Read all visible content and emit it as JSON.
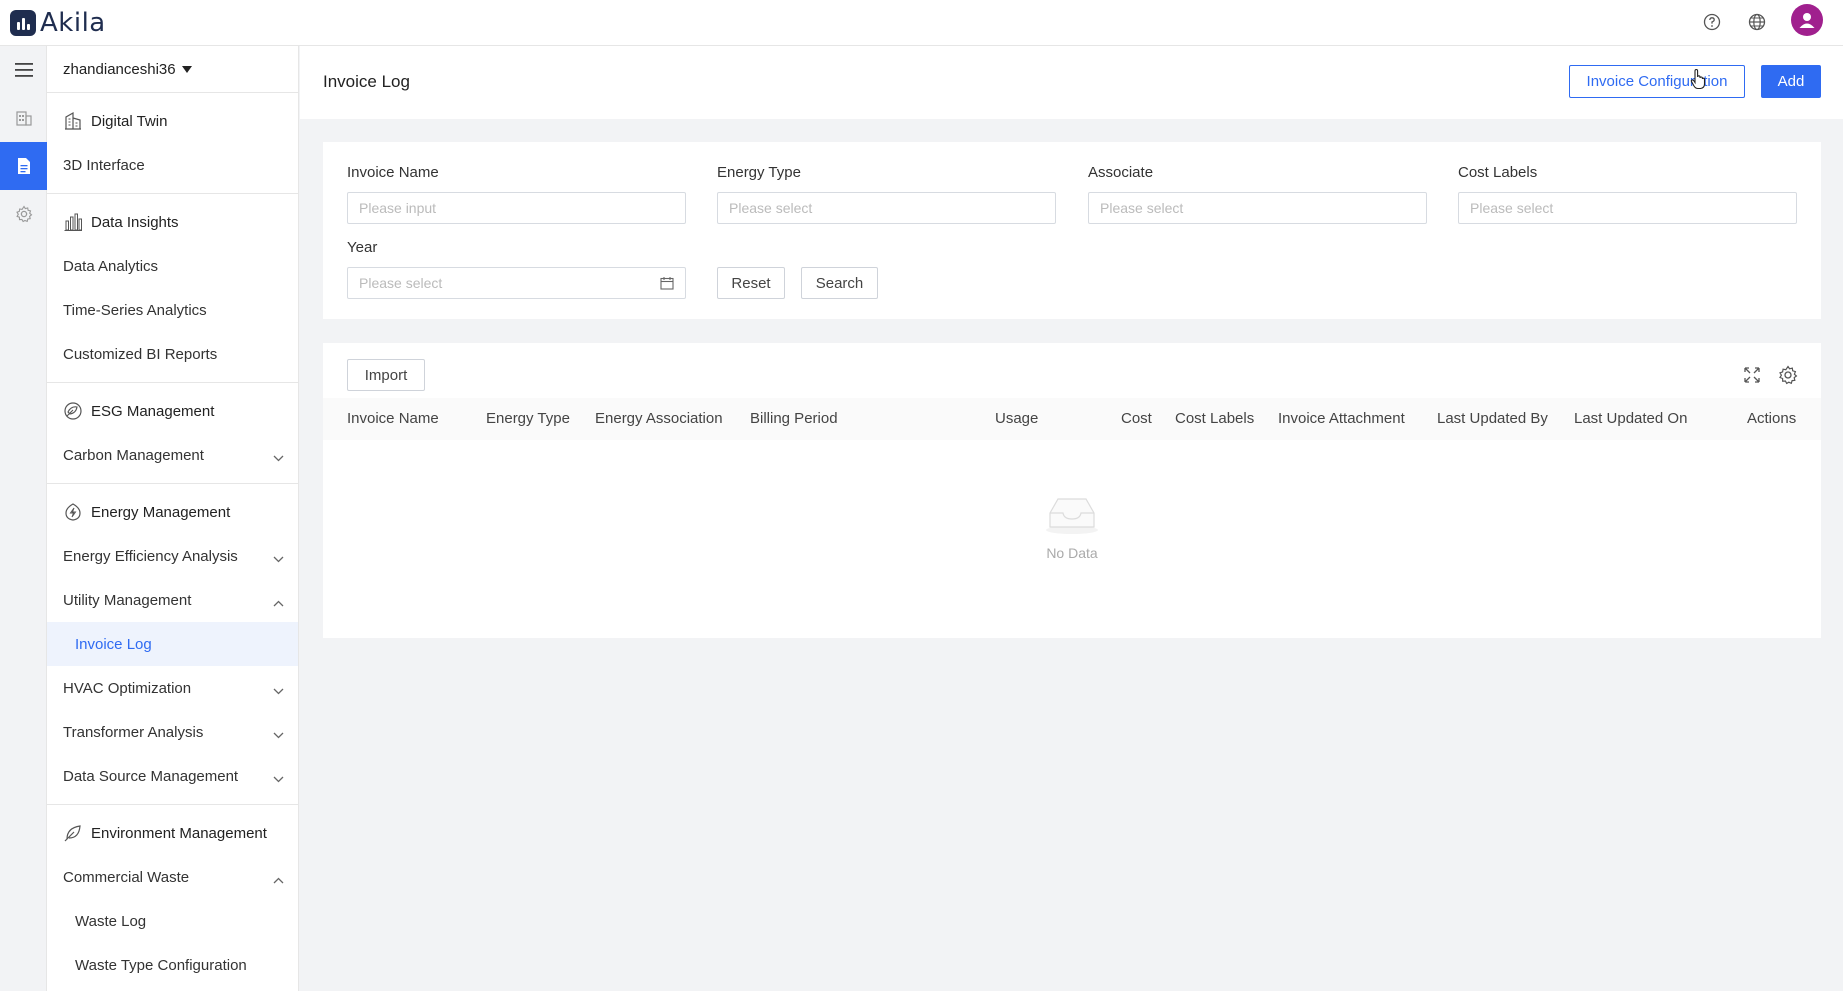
{
  "app": {
    "logo_text": "Akila"
  },
  "colors": {
    "primary": "#2f6bf2",
    "brand": "#1f2d4f",
    "avatar": "#a0208e"
  },
  "header": {
    "icons": [
      "help-icon",
      "globe-icon",
      "user-avatar-icon"
    ]
  },
  "sidebar": {
    "project": "zhandianceshi36",
    "groups": [
      {
        "title": "Digital Twin",
        "items": [
          "3D Interface"
        ]
      },
      {
        "title": "Data Insights",
        "items": [
          "Data Analytics",
          "Time-Series Analytics",
          "Customized BI Reports"
        ]
      },
      {
        "title": "ESG Management",
        "items": [
          "Carbon Management"
        ]
      },
      {
        "title": "Energy Management",
        "items": [
          "Energy Efficiency Analysis",
          "Utility Management",
          "Invoice Log",
          "HVAC Optimization",
          "Transformer Analysis",
          "Data Source Management"
        ]
      },
      {
        "title": "Environment Management",
        "items": [
          "Commercial Waste",
          "Waste Log",
          "Waste Type Configuration"
        ]
      }
    ]
  },
  "page": {
    "title": "Invoice Log",
    "invoice_config_label": "Invoice Configuration",
    "add_label": "Add"
  },
  "filters": {
    "invoice_name": {
      "label": "Invoice Name",
      "placeholder": "Please input"
    },
    "energy_type": {
      "label": "Energy Type",
      "placeholder": "Please select"
    },
    "associate": {
      "label": "Associate",
      "placeholder": "Please select"
    },
    "cost_labels": {
      "label": "Cost Labels",
      "placeholder": "Please select"
    },
    "year": {
      "label": "Year",
      "placeholder": "Please select"
    },
    "reset_label": "Reset",
    "search_label": "Search"
  },
  "table": {
    "import_label": "Import",
    "columns": [
      "Invoice Name",
      "Energy Type",
      "Energy Association",
      "Billing Period",
      "Usage",
      "Cost",
      "Cost Labels",
      "Invoice Attachment",
      "Last Updated By",
      "Last Updated On",
      "Actions"
    ],
    "empty_text": "No Data"
  }
}
